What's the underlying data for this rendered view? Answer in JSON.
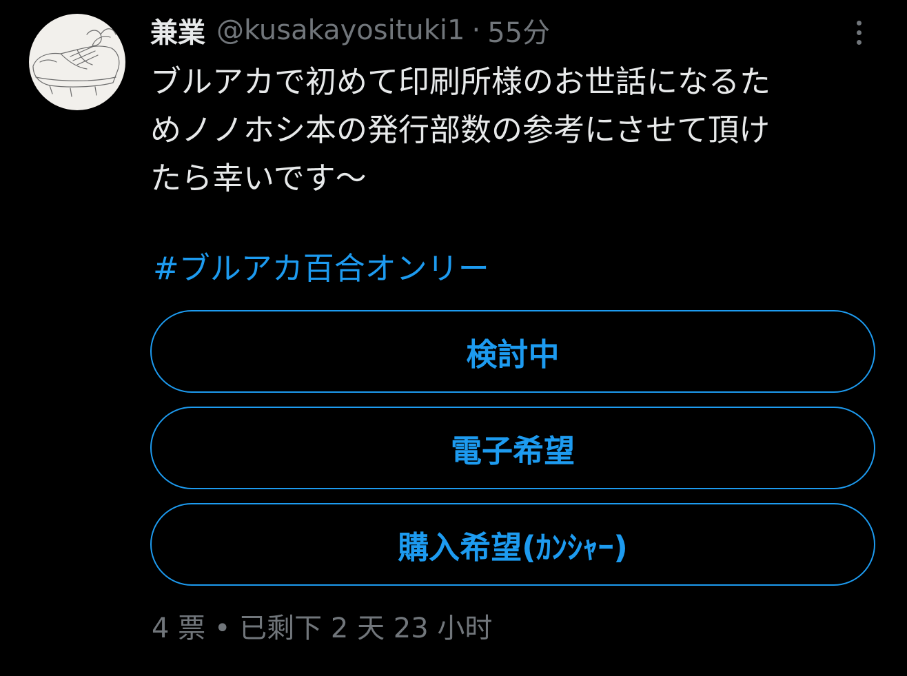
{
  "tweet": {
    "display_name": "兼業",
    "handle": "@kusakayosituki1",
    "separator": "·",
    "time": "55分",
    "text_lines": [
      "ブルアカで初めて印刷所様のお世話になるた",
      "めノノホシ本の発行部数の参考にさせて頂け",
      "たら幸いです～"
    ],
    "hashtag": "#ブルアカ百合オンリー",
    "more_icon": "more-vertical-icon",
    "avatar_icon": "sneaker-sketch-avatar"
  },
  "poll": {
    "options": [
      "検討中",
      "電子希望",
      "購入希望(ｶﾝｼｬｰ)"
    ],
    "meta": "4 票 • 已剩下 2 天 23 小时"
  },
  "colors": {
    "background": "#000000",
    "accent": "#1d9bf0",
    "text_primary": "#e7e9ea",
    "text_secondary": "#71767b"
  }
}
